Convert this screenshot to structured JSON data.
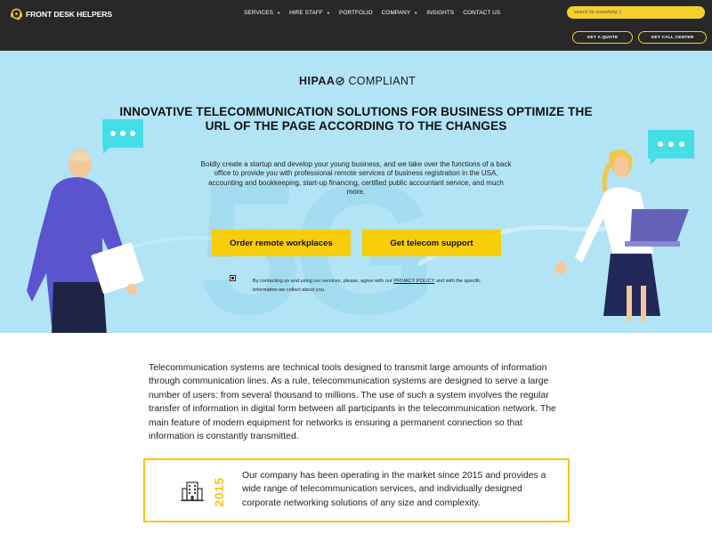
{
  "header": {
    "logo_text": "FRONT DESK HELPERS",
    "nav": [
      {
        "label": "SERVICES",
        "caret": true
      },
      {
        "label": "HIRE STAFF",
        "caret": true
      },
      {
        "label": "PORTFOLIO",
        "caret": false
      },
      {
        "label": "COMPANY",
        "caret": true
      },
      {
        "label": "INSIGHTS",
        "caret": false
      },
      {
        "label": "CONTACT US",
        "caret": false
      }
    ],
    "search_placeholder": "search for something :)",
    "quote_button": "GET A QUOTE",
    "call_button": "GET CALL CENTER",
    "accent_color": "#f5cf2a"
  },
  "hero": {
    "hipaa_strong": "HIPAA",
    "hipaa_light": "COMPLIANT",
    "title": "INNOVATIVE TELECOMMUNICATION SOLUTIONS FOR BUSINESS OPTIMIZE THE URL OF THE PAGE ACCORDING TO THE CHANGES",
    "description": "Boldly create a startup and develop your young business, and we take over the functions of a back office to provide you with professional remote services of business registration in the USA, accounting and bookkeeping, start-up financing, certified public accountant service, and much more.",
    "cta_primary": "Order remote workplaces",
    "cta_secondary": "Get telecom support",
    "consent_before": "By contacting us and using our services, please, agree with our ",
    "consent_link": "PRIVACY POLICY",
    "consent_after": " and with the specific information we collect about you.",
    "background_word": "5G",
    "background_color": "#b2e4f6"
  },
  "main": {
    "intro": "Telecommunication systems are technical tools designed to transmit large amounts of information through communication lines. As a rule, telecommunication systems are designed to serve a large number of users: from several thousand to millions. The use of such a system involves the regular transfer of information in digital form between all participants in the telecommunication network. The main feature of modern equipment for networks is ensuring a permanent connection so that information is constantly transmitted.",
    "card": {
      "year": "2015",
      "text": "Our company has been operating in the market since 2015 and provides a wide range of telecommunication services, and individually designed corporate networking solutions of any size and complexity.",
      "icon": "office-building-icon"
    }
  }
}
